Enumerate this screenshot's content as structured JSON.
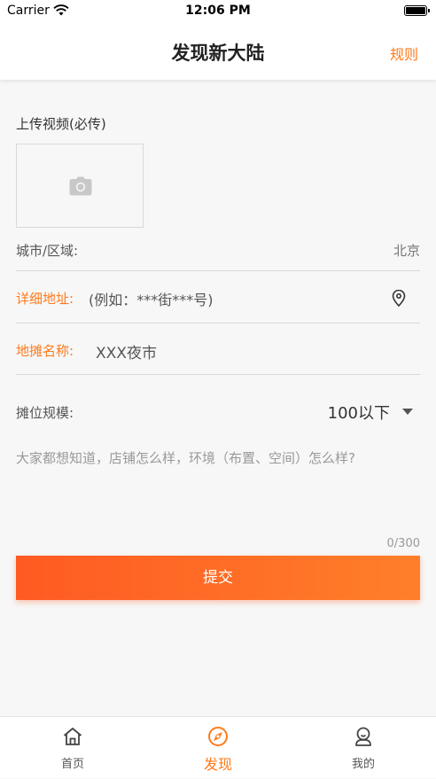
{
  "status_bar": {
    "carrier": "Carrier",
    "time": "12:06 PM"
  },
  "nav": {
    "title": "发现新大陆",
    "right_action": "规则"
  },
  "form": {
    "upload_label": "上传视频(必传)",
    "city": {
      "label": "城市/区域:",
      "value": "北京"
    },
    "address": {
      "label": "详细地址:",
      "placeholder": "(例如：***街***号)"
    },
    "stall_name": {
      "label": "地摊名称:",
      "value": "XXX夜市"
    },
    "stall_scale": {
      "label": "摊位规模:",
      "value": "100以下"
    },
    "description": {
      "placeholder": "大家都想知道，店铺怎么样，环境（布置、空间）怎么样?",
      "counter": "0/300"
    },
    "submit_label": "提交"
  },
  "tabs": [
    {
      "label": "首页",
      "icon": "home-icon",
      "active": false
    },
    {
      "label": "发现",
      "icon": "compass-icon",
      "active": true
    },
    {
      "label": "我的",
      "icon": "profile-icon",
      "active": false
    }
  ],
  "colors": {
    "accent": "#ff7a1a",
    "button_start": "#ff5a22",
    "button_end": "#ff7f2a"
  }
}
